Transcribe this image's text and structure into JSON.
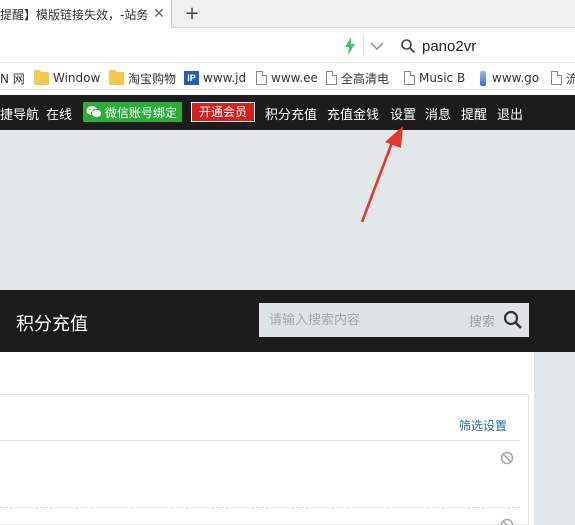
{
  "browser": {
    "tab": {
      "title": "提醒】模版链接失效，-站务",
      "close": "✕"
    },
    "new_tab": "+",
    "search_query": "pano2vr"
  },
  "bookmarks": [
    {
      "label": "N 网",
      "icon": "none"
    },
    {
      "label": "Window",
      "icon": "folder-icon"
    },
    {
      "label": "淘宝购物",
      "icon": "folder-icon"
    },
    {
      "label": "www.jd",
      "icon": "ip-icon"
    },
    {
      "label": "www.ee",
      "icon": "page-icon"
    },
    {
      "label": "全高清电",
      "icon": "page-icon"
    },
    {
      "label": "Music B",
      "icon": "page-icon"
    },
    {
      "label": "www.go",
      "icon": "bottle-icon"
    },
    {
      "label": "流",
      "icon": "page-icon"
    }
  ],
  "ip_badge": "IP",
  "topnav": {
    "items": [
      "捷导航",
      "在线"
    ],
    "wechat_label": "微信账号绑定",
    "vip_label": "开通会员",
    "right_items": [
      "积分充值",
      "充值金钱",
      "设置",
      "消息",
      "提醒",
      "退出"
    ]
  },
  "section": {
    "title": "积分充值",
    "search_placeholder": "请输入搜索内容",
    "search_button": "搜索"
  },
  "content": {
    "filter_link": "筛选设置"
  },
  "colors": {
    "nav_bg": "#1c1c1c",
    "wechat_green": "#2aae38",
    "vip_red": "#d91e1e",
    "banner_bg": "#e2e8ea",
    "annotation_arrow": "#e8352b"
  }
}
